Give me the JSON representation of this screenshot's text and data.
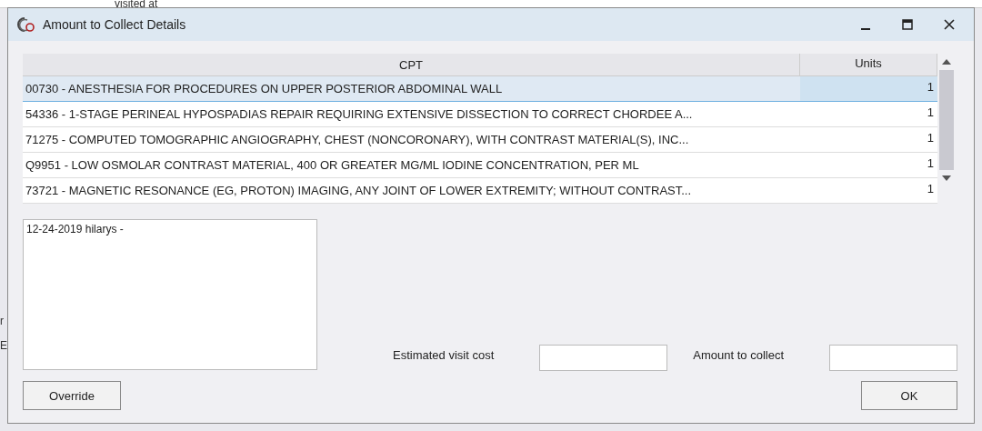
{
  "background": {
    "label": "visited at",
    "fragments": [
      "r",
      "E"
    ]
  },
  "window": {
    "title": "Amount to Collect Details"
  },
  "table": {
    "columns": [
      "CPT",
      "Units"
    ],
    "rows": [
      {
        "cpt": "00730 - ANESTHESIA FOR PROCEDURES ON UPPER POSTERIOR ABDOMINAL WALL",
        "units": "1",
        "selected": true
      },
      {
        "cpt": "54336 - 1-STAGE PERINEAL HYPOSPADIAS REPAIR REQUIRING EXTENSIVE DISSECTION TO CORRECT CHORDEE A...",
        "units": "1",
        "selected": false
      },
      {
        "cpt": "71275 - COMPUTED TOMOGRAPHIC ANGIOGRAPHY, CHEST (NONCORONARY), WITH CONTRAST MATERIAL(S), INC...",
        "units": "1",
        "selected": false
      },
      {
        "cpt": "Q9951 - LOW OSMOLAR CONTRAST MATERIAL, 400 OR GREATER MG/ML IODINE CONCENTRATION, PER ML",
        "units": "1",
        "selected": false
      },
      {
        "cpt": "73721 - MAGNETIC RESONANCE (EG, PROTON) IMAGING, ANY JOINT OF LOWER EXTREMITY; WITHOUT CONTRAST...",
        "units": "1",
        "selected": false
      }
    ]
  },
  "notes": {
    "value": "12-24-2019 hilarys -"
  },
  "fields": [
    {
      "label": "Estimated visit cost"
    },
    {
      "label": "Amount to collect"
    }
  ],
  "buttons": {
    "left": "Override",
    "right": "OK"
  }
}
